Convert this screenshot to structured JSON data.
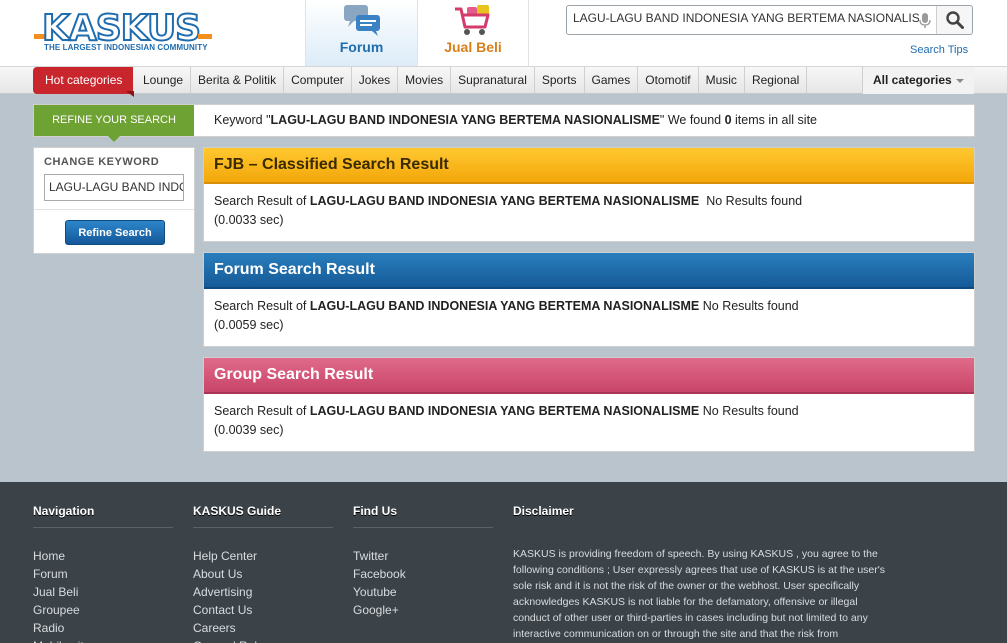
{
  "header": {
    "logo_text": "KASKUS",
    "logo_tagline": "THE LARGEST INDONESIAN COMMUNITY",
    "nav": [
      {
        "label": "Forum",
        "icon": "forum-chat-icon"
      },
      {
        "label": "Jual Beli",
        "icon": "shopping-cart-icon"
      }
    ],
    "search": {
      "value": "LAGU-LAGU BAND INDONESIA YANG BERTEMA NASIONALISME",
      "tips_label": "Search Tips"
    }
  },
  "catbar": {
    "hot_label": "Hot categories",
    "items": [
      "Lounge",
      "Berita & Politik",
      "Computer",
      "Jokes",
      "Movies",
      "Supranatural",
      "Sports",
      "Games",
      "Otomotif",
      "Music",
      "Regional"
    ],
    "all_label": "All categories"
  },
  "refine": {
    "tab_label": "REFINE YOUR SEARCH",
    "kw_prefix": "Keyword \"",
    "keyword": "LAGU-LAGU BAND INDONESIA YANG BERTEMA NASIONALISME",
    "kw_mid": "\" We found ",
    "count": "0",
    "kw_suffix": " items in all site"
  },
  "left_panel": {
    "label": "CHANGE KEYWORD",
    "input_value": "LAGU-LAGU BAND INDONESIA YANG BERTEMA NASIONALISME",
    "button_label": "Refine Search"
  },
  "results": {
    "prefix": "Search Result of ",
    "fjb": {
      "title": "FJB – Classified Search Result",
      "keyword": "LAGU-LAGU BAND INDONESIA YANG BERTEMA NASIONALISME",
      "status": "  No Results found",
      "time": "(0.0033 sec)"
    },
    "forum": {
      "title": "Forum Search Result",
      "keyword": "LAGU-LAGU BAND INDONESIA YANG BERTEMA NASIONALISME",
      "status": " No Results found",
      "time": "(0.0059 sec)"
    },
    "group": {
      "title": "Group Search Result",
      "keyword": "LAGU-LAGU BAND INDONESIA YANG BERTEMA NASIONALISME",
      "status": " No Results found",
      "time": "(0.0039 sec)"
    }
  },
  "footer": {
    "navigation": {
      "title": "Navigation",
      "links": [
        "Home",
        "Forum",
        "Jual Beli",
        "Groupee",
        "Radio",
        "Mobile site"
      ]
    },
    "guide": {
      "title": "KASKUS Guide",
      "links": [
        "Help Center",
        "About Us",
        "Advertising",
        "Contact Us",
        "Careers",
        "General Rules"
      ]
    },
    "findus": {
      "title": "Find Us",
      "links": [
        "Twitter",
        "Facebook",
        "Youtube",
        "Google+"
      ]
    },
    "disclaimer": {
      "title": "Disclaimer",
      "text": "KASKUS is providing freedom of speech. By using KASKUS , you agree to the following conditions ; User expressly agrees that use of KASKUS is at the user's sole risk and it is not the risk of the owner or the webhost. User specifically acknowledges KASKUS is not liable for the defamatory, offensive or illegal conduct of other user or third-parties in cases including but not limited to any interactive communication on or through the site and that the risk from"
    }
  },
  "colors": {
    "brand_blue": "#1f6cae",
    "brand_orange": "#f3901d",
    "hot_red": "#c9252c",
    "refine_green": "#6ea233",
    "fjb_yellow": "#f3a70a",
    "forum_blue": "#155a98",
    "group_pink": "#c84569",
    "footer_bg": "#3b4349"
  }
}
